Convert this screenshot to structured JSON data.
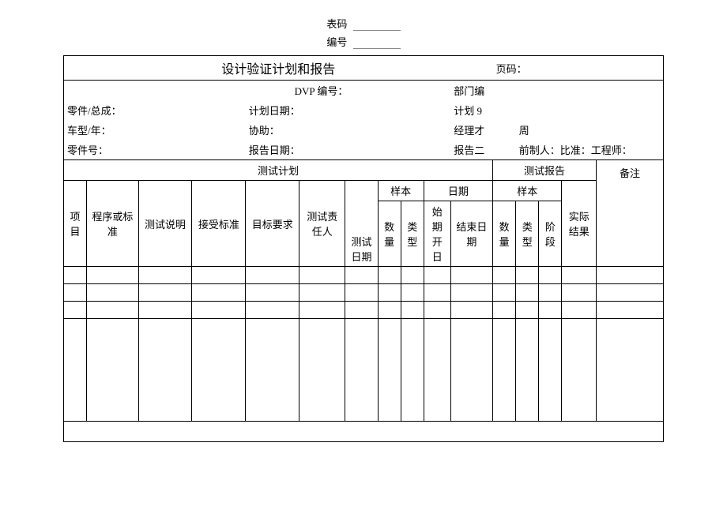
{
  "meta": {
    "code_label": "表码",
    "number_label": "编号"
  },
  "header": {
    "title": "设计验证计划和报告",
    "page_label": "页码：",
    "dvp_label": "DVP 编号：",
    "dept_label": "部门编",
    "r1c1": "零件/总成：",
    "r1c2": "计划日期：",
    "r1c3": "计划 9",
    "r2c1": "车型/年：",
    "r2c2": "协助：",
    "r2c3": "经理才",
    "r2c4": "周",
    "r3c1": "零件号：",
    "r3c2": "报告日期：",
    "r3c3": "报告二",
    "r3c4": "前制人：比准：工程师："
  },
  "sections": {
    "test_plan": "测试计划",
    "test_report": "测试报告",
    "remarks": "备注"
  },
  "cols": {
    "item": "项目",
    "procedure": "程序或标准",
    "desc": "测试说明",
    "accept": "接受标准",
    "target": "目标要求",
    "resp": "测试责任人",
    "test_date": "测试日期",
    "sample": "样本",
    "qty": "数量",
    "type": "类型",
    "date": "日期",
    "start_date": "始期开日",
    "end_date": "结束日期",
    "stage": "阶段",
    "actual": "实际结果"
  }
}
